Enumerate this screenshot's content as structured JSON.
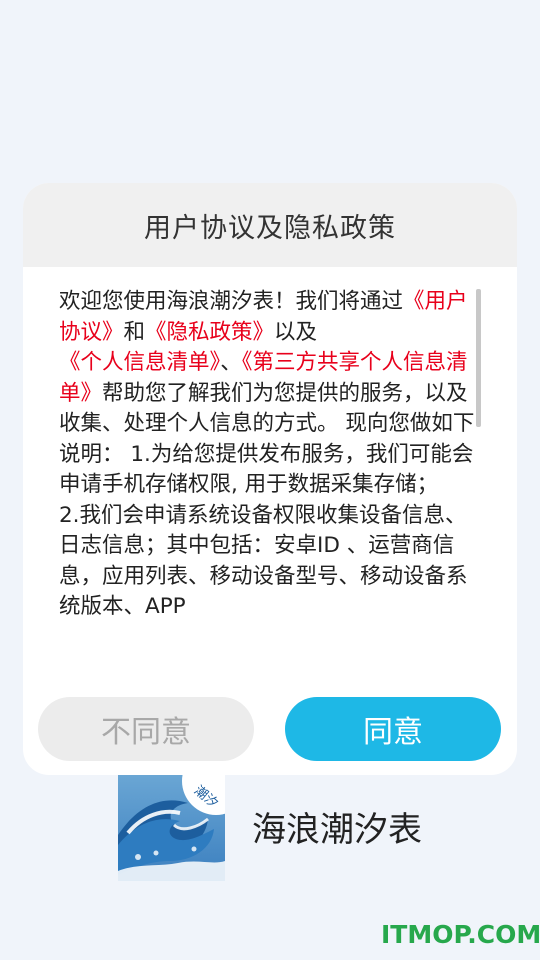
{
  "dialog": {
    "title": "用户协议及隐私政策",
    "intro_before": "欢迎您使用海浪潮汐表！我们将通过",
    "link_user_agreement": "《用户协议》",
    "and": "和",
    "link_privacy_policy": "《隐私政策》",
    "and_also": "以及",
    "link_personal_info_list": "《个人信息清单》",
    "separator": "、",
    "link_third_party_list": "《第三方共享个人信息清单》",
    "intro_after": "帮助您了解我们为您提供的服务，以及收集、处理个人信息的方式。 现向您做如下说明： 1.为给您提供发布服务，我们可能会申请手机存储权限, 用于数据采集存储；",
    "point_2": " 2.我们会申请系统设备权限收集设备信息、日志信息；其中包括：安卓ID 、运营商信息，应用列表、移动设备型号、移动设备系统版本、APP",
    "disagree_label": "不同意",
    "agree_label": "同意"
  },
  "app": {
    "name": "海浪潮汐表",
    "icon_badge": "潮汐"
  },
  "watermark": "ITMOP.COM",
  "colors": {
    "link": "#e8001b",
    "agree_button": "#1eb8e6",
    "disagree_button": "#ececec",
    "background": "#f0f4fa"
  }
}
